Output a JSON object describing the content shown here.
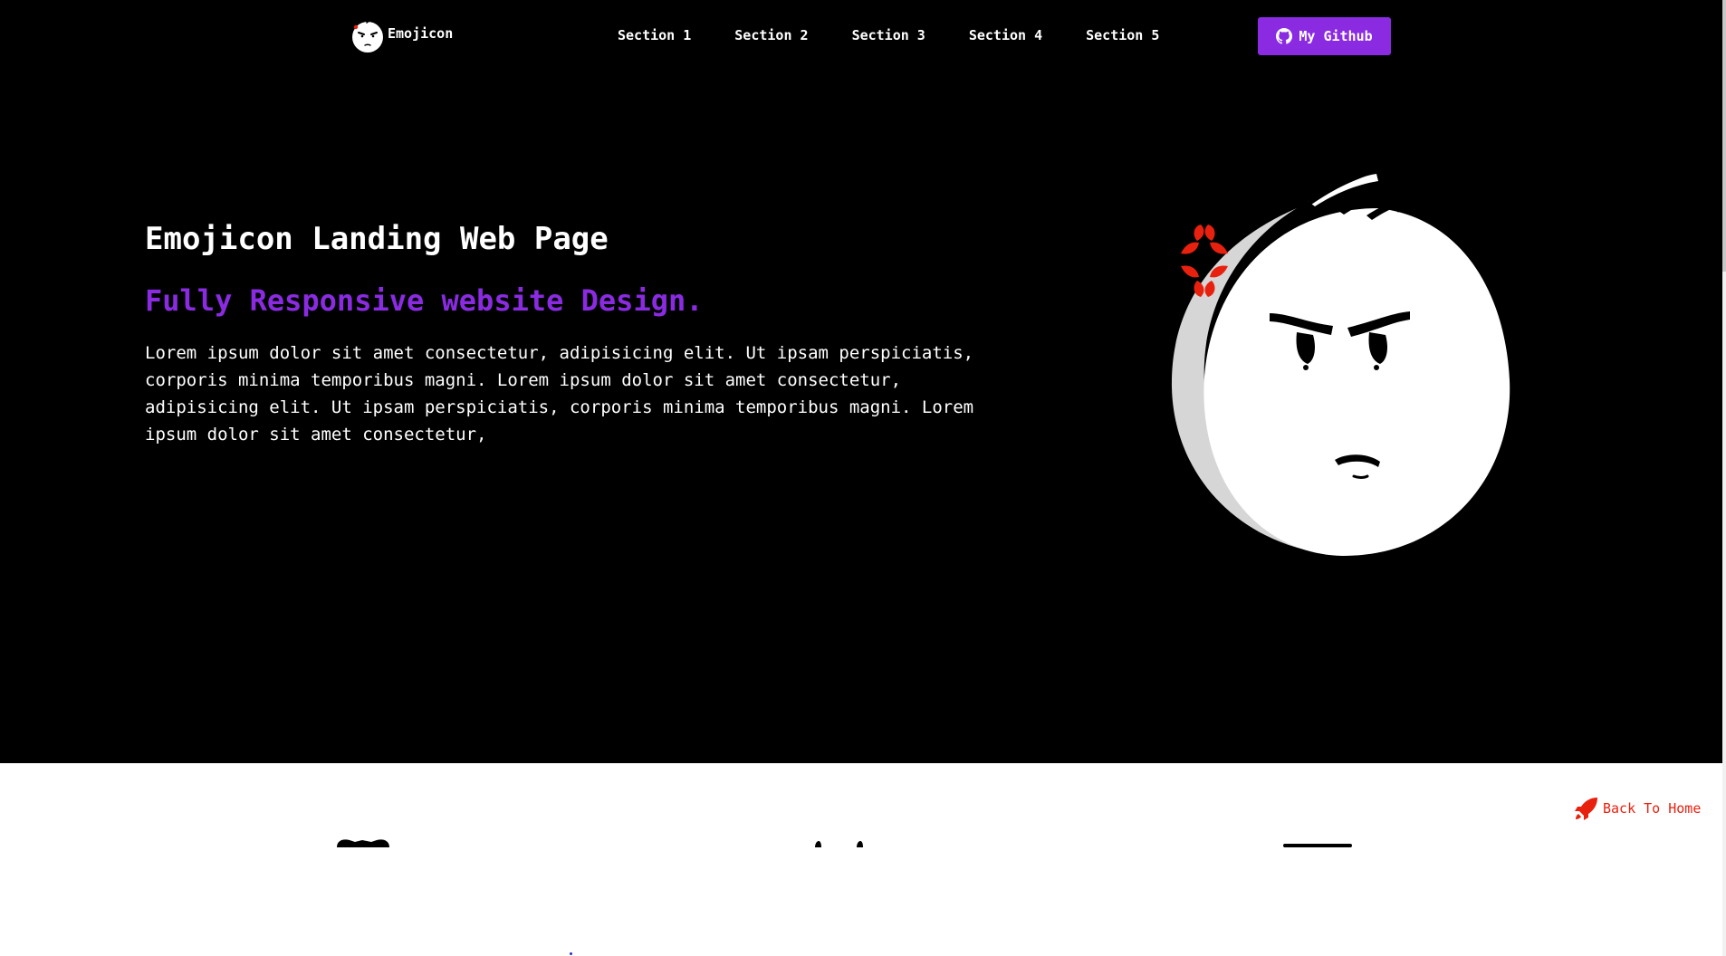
{
  "brand": {
    "name": "Emojicon",
    "logo_icon": "grumpy-face-icon"
  },
  "nav": {
    "links": [
      "Section 1",
      "Section 2",
      "Section 3",
      "Section 4",
      "Section 5"
    ]
  },
  "github_button": {
    "label": "My Github",
    "icon": "github-icon"
  },
  "hero": {
    "title": "Emojicon Landing Web Page",
    "subtitle": "Fully Responsive website Design.",
    "body": "Lorem ipsum dolor sit amet consectetur, adipisicing elit. Ut ipsam perspiciatis, corporis minima temporibus magni. Lorem ipsum dolor sit amet consectetur, adipisicing elit. Ut ipsam perspiciatis, corporis minima temporibus magni. Lorem ipsum dolor sit amet consectetur,",
    "illustration": "angry-face-icon"
  },
  "back_to_home": {
    "label": "Back To Home",
    "icon": "rocket-icon"
  },
  "colors": {
    "accent": "#8a2be2",
    "hero_background": "#000000",
    "anger_mark": "#e8210f",
    "back_link": "#e8210f"
  }
}
